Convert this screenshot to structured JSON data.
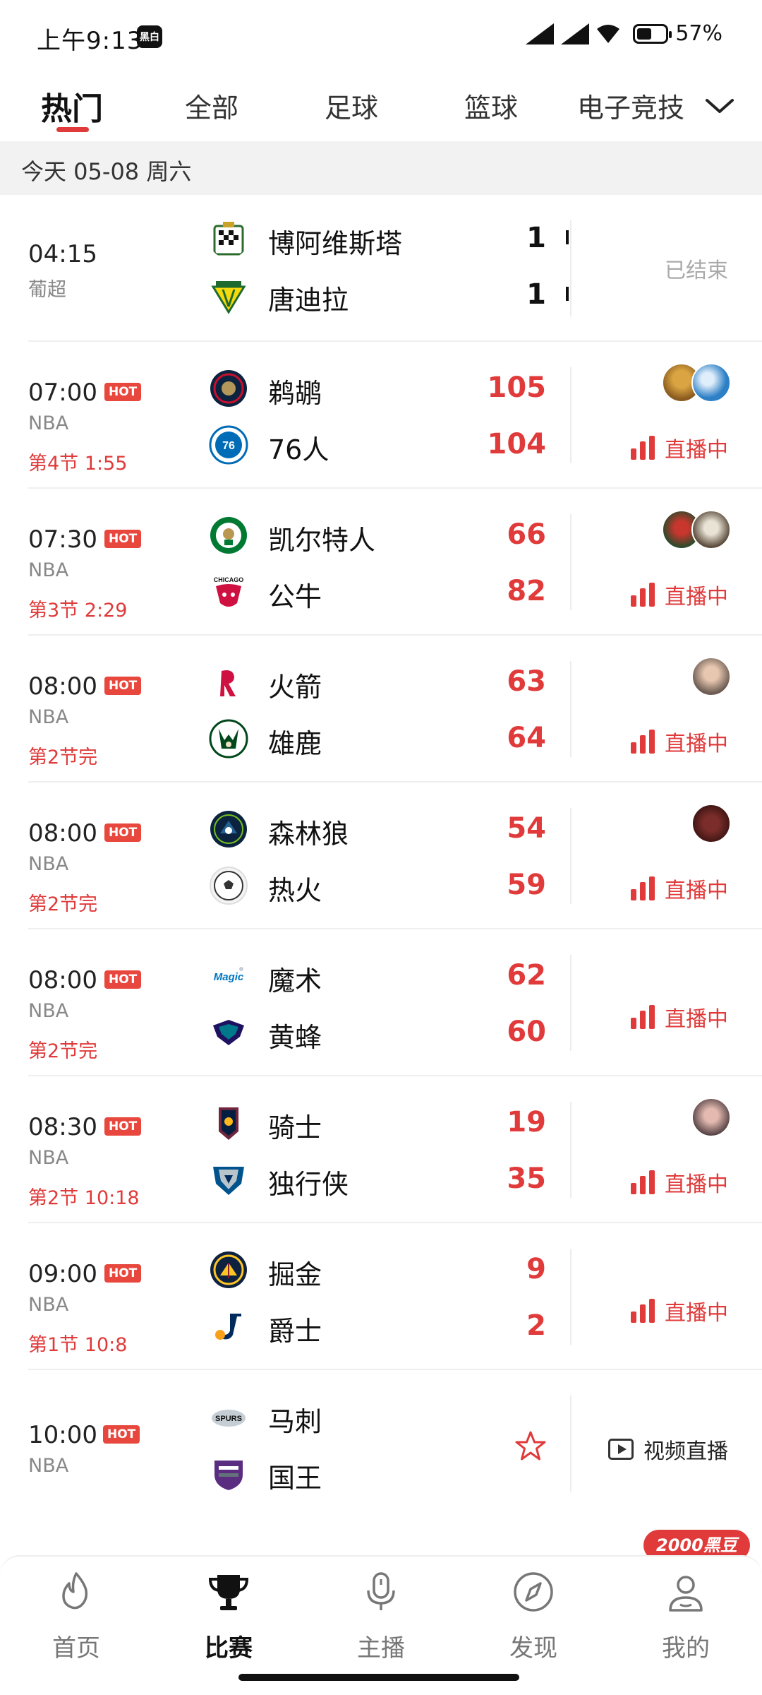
{
  "status_bar": {
    "time": "上午9:13",
    "badge": "黑白",
    "battery": "57%"
  },
  "tabs": [
    {
      "label": "热门",
      "active": true
    },
    {
      "label": "全部"
    },
    {
      "label": "足球"
    },
    {
      "label": "篮球"
    },
    {
      "label": "电子竞技"
    }
  ],
  "date_header": "今天 05-08 周六",
  "hot_label": "HOT",
  "live_label": "直播中",
  "matches": [
    {
      "time": "04:15",
      "hot": false,
      "league": "葡超",
      "status": "",
      "home": {
        "name": "博阿维斯塔",
        "score": "1"
      },
      "away": {
        "name": "唐迪拉",
        "score": "1"
      },
      "right": "已结束"
    },
    {
      "time": "07:00",
      "hot": true,
      "league": "NBA",
      "status": "第4节 1:55",
      "home": {
        "name": "鹈鹕",
        "score": "105"
      },
      "away": {
        "name": "76人",
        "score": "104"
      }
    },
    {
      "time": "07:30",
      "hot": true,
      "league": "NBA",
      "status": "第3节 2:29",
      "home": {
        "name": "凯尔特人",
        "score": "66"
      },
      "away": {
        "name": "公牛",
        "score": "82"
      }
    },
    {
      "time": "08:00",
      "hot": true,
      "league": "NBA",
      "status": "第2节完",
      "home": {
        "name": "火箭",
        "score": "63"
      },
      "away": {
        "name": "雄鹿",
        "score": "64"
      }
    },
    {
      "time": "08:00",
      "hot": true,
      "league": "NBA",
      "status": "第2节完",
      "home": {
        "name": "森林狼",
        "score": "54"
      },
      "away": {
        "name": "热火",
        "score": "59"
      }
    },
    {
      "time": "08:00",
      "hot": true,
      "league": "NBA",
      "status": "第2节完",
      "home": {
        "name": "魔术",
        "score": "62"
      },
      "away": {
        "name": "黄蜂",
        "score": "60"
      }
    },
    {
      "time": "08:30",
      "hot": true,
      "league": "NBA",
      "status": "第2节 10:18",
      "home": {
        "name": "骑士",
        "score": "19"
      },
      "away": {
        "name": "独行侠",
        "score": "35"
      }
    },
    {
      "time": "09:00",
      "hot": true,
      "league": "NBA",
      "status": "第1节 10:8",
      "home": {
        "name": "掘金",
        "score": "9"
      },
      "away": {
        "name": "爵士",
        "score": "2"
      }
    },
    {
      "time": "10:00",
      "hot": true,
      "league": "NBA",
      "status": "",
      "home": {
        "name": "马刺",
        "score": ""
      },
      "away": {
        "name": "国王",
        "score": ""
      },
      "right": "视频直播"
    }
  ],
  "bottom_nav": [
    {
      "label": "首页",
      "icon": "flame-icon"
    },
    {
      "label": "比赛",
      "icon": "trophy-icon",
      "active": true
    },
    {
      "label": "主播",
      "icon": "microphone-icon"
    },
    {
      "label": "发现",
      "icon": "compass-icon"
    },
    {
      "label": "我的",
      "icon": "user-icon"
    }
  ],
  "reward_badge": "2000黑豆",
  "colors": {
    "accent": "#e03a3a",
    "hot_badge": "#e8473e",
    "date_bg": "#f2f2f2"
  }
}
